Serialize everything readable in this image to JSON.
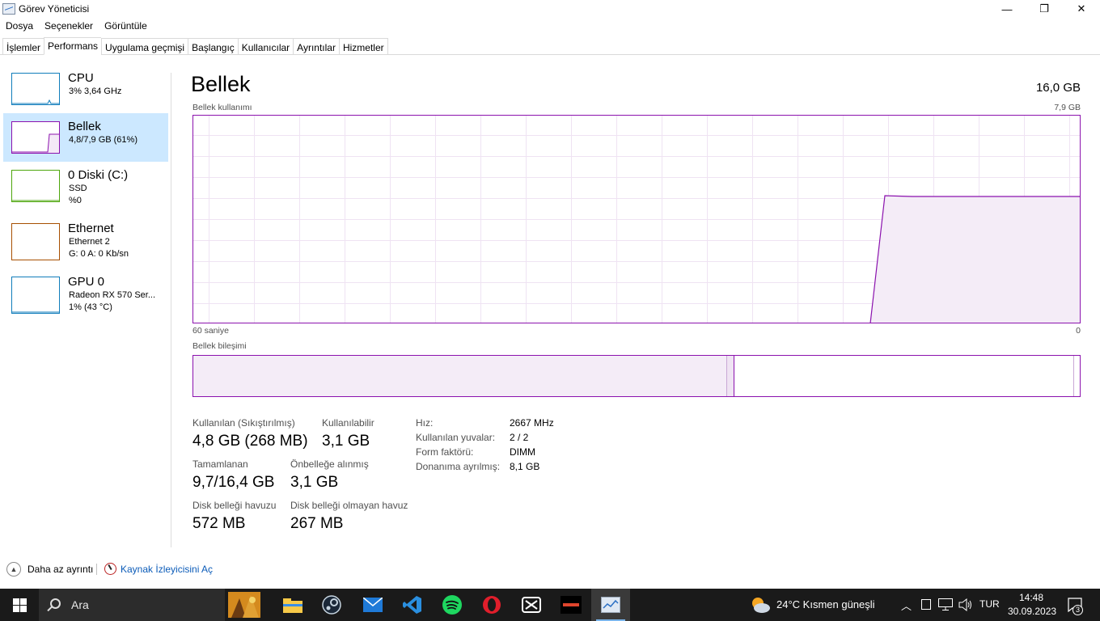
{
  "window": {
    "title": "Görev Yöneticisi",
    "min_glyph": "—",
    "max_glyph": "❐",
    "close_glyph": "✕"
  },
  "menu": [
    "Dosya",
    "Seçenekler",
    "Görüntüle"
  ],
  "tabs": [
    "İşlemler",
    "Performans",
    "Uygulama geçmişi",
    "Başlangıç",
    "Kullanıcılar",
    "Ayrıntılar",
    "Hizmetler"
  ],
  "active_tab": "Performans",
  "sidebar": {
    "items": [
      {
        "title": "CPU",
        "line1": "3% 3,64 GHz",
        "line2": "",
        "color": "#117dbb"
      },
      {
        "title": "Bellek",
        "line1": "4,8/7,9 GB (61%)",
        "line2": "",
        "color": "#8b12ae"
      },
      {
        "title": "0 Diski (C:)",
        "line1": "SSD",
        "line2": "%0",
        "color": "#4da60c"
      },
      {
        "title": "Ethernet",
        "line1": "Ethernet 2",
        "line2": "G: 0 A: 0 Kb/sn",
        "color": "#a74f01"
      },
      {
        "title": "GPU 0",
        "line1": "Radeon RX 570 Ser...",
        "line2": "1% (43 °C)",
        "color": "#117dbb"
      }
    ]
  },
  "memory": {
    "title": "Bellek",
    "total": "16,0 GB",
    "usage_label": "Bellek kullanımı",
    "usage_max": "7,9 GB",
    "time_left": "60 saniye",
    "time_right": "0",
    "composition_label": "Bellek bileşimi",
    "accent_color": "#8b12ae",
    "stats": {
      "in_use_label": "Kullanılan (Sıkıştırılmış)",
      "in_use_value": "4,8 GB (268 MB)",
      "available_label": "Kullanılabilir",
      "available_value": "3,1 GB",
      "committed_label": "Tamamlanan",
      "committed_value": "9,7/16,4 GB",
      "cached_label": "Önbelleğe alınmış",
      "cached_value": "3,1 GB",
      "paged_label": "Disk belleği havuzu",
      "paged_value": "572 MB",
      "nonpaged_label": "Disk belleği olmayan havuz",
      "nonpaged_value": "267 MB"
    },
    "details": [
      {
        "label": "Hız:",
        "value": "2667 MHz"
      },
      {
        "label": "Kullanılan yuvalar:",
        "value": "2 / 2"
      },
      {
        "label": "Form faktörü:",
        "value": "DIMM"
      },
      {
        "label": "Donanıma ayrılmış:",
        "value": "8,1 GB"
      }
    ]
  },
  "footer": {
    "fewer_details": "Daha az ayrıntı",
    "open_resmon": "Kaynak İzleyicisini Aç"
  },
  "taskbar": {
    "search_placeholder": "Ara",
    "weather": "24°C  Kısmen güneşli",
    "lang": "TUR",
    "time": "14:48",
    "date": "30.09.2023",
    "notifications": "3",
    "apps": [
      "autumn-app",
      "file-explorer",
      "steam",
      "mail",
      "vscode",
      "spotify",
      "opera",
      "capcut",
      "ryzen-master",
      "task-manager"
    ]
  }
}
